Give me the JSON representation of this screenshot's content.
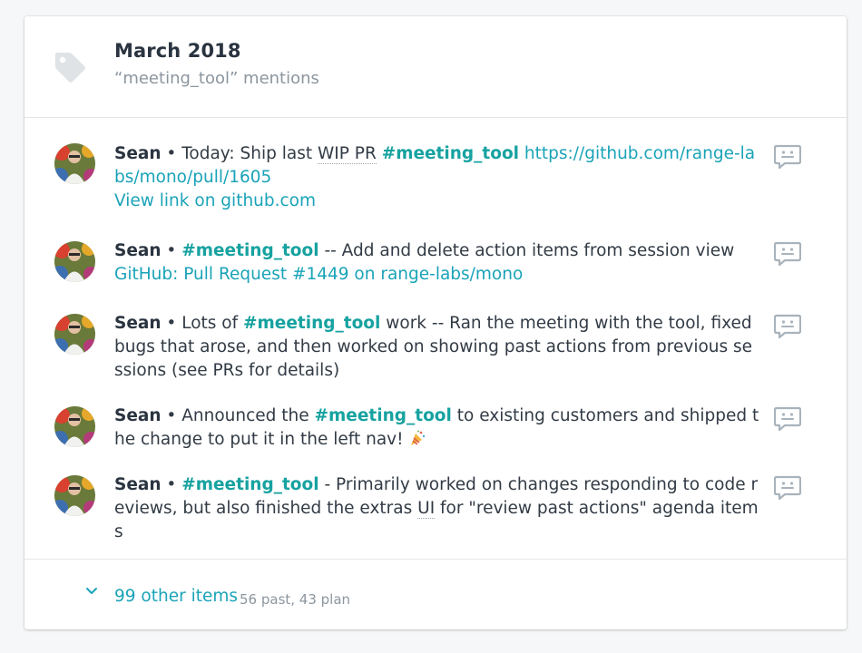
{
  "header": {
    "title": "March 2018",
    "subtitle": "“meeting_tool” mentions",
    "icon": "tag-icon"
  },
  "items": [
    {
      "author": "Sean",
      "bullet": "•",
      "text1": "Today: Ship last ",
      "abbr": "WIP PR",
      "hashtag": "#meeting_tool",
      "link": "https://github.com/range-labs/mono/pull/1605",
      "link2": "View link on github.com"
    },
    {
      "author": "Sean",
      "bullet": "•",
      "hashtag": "#meeting_tool",
      "text1": " -- Add and delete action items from session view",
      "link": "GitHub: Pull Request #1449 on range-labs/mono"
    },
    {
      "author": "Sean",
      "bullet": "•",
      "text1": "Lots of ",
      "hashtag": "#meeting_tool",
      "text2": " work -- Ran the meeting with the tool, fixed bugs that arose, and then worked on showing past actions from previous sessions (see PRs for details)"
    },
    {
      "author": "Sean",
      "bullet": "•",
      "text1": "Announced the ",
      "hashtag": "#meeting_tool",
      "text2": " to existing customers and shipped the change to put it in the left nav! ",
      "emoji": "party-popper-icon"
    },
    {
      "author": "Sean",
      "bullet": "•",
      "hashtag": "#meeting_tool",
      "text1": " - Primarily worked on changes responding to code reviews, but also finished the extras ",
      "abbr": "UI",
      "text2": " for \"review past actions\" agenda items"
    }
  ],
  "footer": {
    "link": "99 other items",
    "meta": "56 past, 43 plan",
    "icon": "chevron-down-icon"
  },
  "colors": {
    "accent": "#16a2a0",
    "link": "#1aa3b8",
    "text": "#323b45",
    "muted": "#8c969f",
    "icon": "#a9b3bb"
  }
}
